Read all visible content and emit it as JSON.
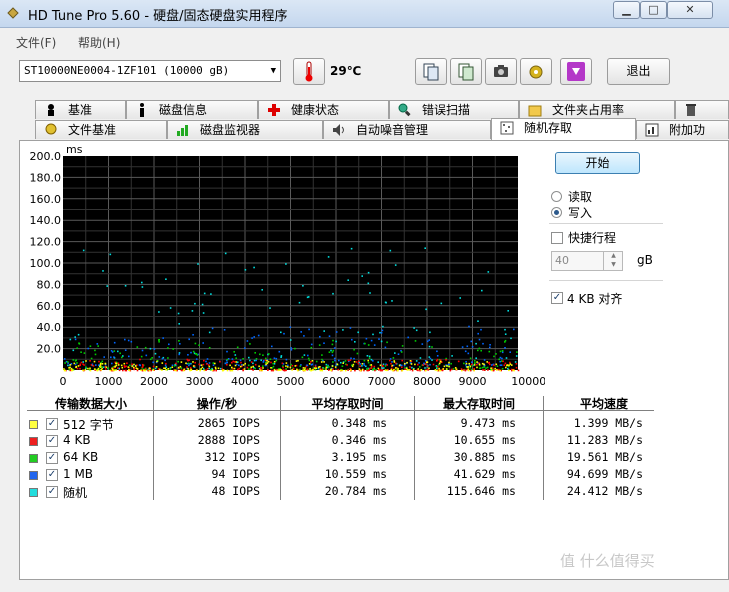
{
  "window": {
    "title": "HD Tune Pro 5.60 - 硬盘/固态硬盘实用程序",
    "minimize_glyph": "▁",
    "maximize_glyph": "□",
    "close_glyph": "✕"
  },
  "menu": {
    "file": "文件(F)",
    "help": "帮助(H)"
  },
  "toolbar": {
    "drive": "ST10000NE0004-1ZF101 (10000 gB)",
    "temperature": "29℃",
    "exit_label": "退出",
    "icons": [
      "copy-info-icon",
      "copy-screenshot-icon",
      "camera-icon",
      "options-icon",
      "save-icon"
    ]
  },
  "tabs_row1": [
    "基准",
    "磁盘信息",
    "健康状态",
    "错误扫描",
    "文件夹占用率",
    ""
  ],
  "tabs_row2": [
    "文件基准",
    "磁盘监视器",
    "自动噪音管理",
    "随机存取",
    "附加功"
  ],
  "active_tab": "随机存取",
  "chart_data": {
    "type": "scatter",
    "ylabel": "ms",
    "xunit": "gB",
    "xlim": [
      0,
      10000
    ],
    "ylim": [
      0,
      200
    ],
    "yticks": [
      "200.0",
      "180.0",
      "160.0",
      "140.0",
      "120.0",
      "100.0",
      "80.0",
      "60.0",
      "40.0",
      "20.0"
    ],
    "xticks": [
      "0",
      "1000",
      "2000",
      "3000",
      "4000",
      "5000",
      "6000",
      "7000",
      "8000",
      "9000",
      "10000gB"
    ],
    "grid": true,
    "background": "#000000",
    "series": [
      {
        "name": "512 字节",
        "color": "#ffff00",
        "ymin": 0.2,
        "ymax": 9.5
      },
      {
        "name": "4 KB",
        "color": "#ff0000",
        "ymin": 0.2,
        "ymax": 10.7
      },
      {
        "name": "64 KB",
        "color": "#00cc00",
        "ymin": 1,
        "ymax": 30.9
      },
      {
        "name": "1 MB",
        "color": "#0066ff",
        "ymin": 5,
        "ymax": 41.6
      },
      {
        "name": "随机",
        "color": "#00dddd",
        "ymin": 2,
        "ymax": 115.6
      }
    ]
  },
  "controls": {
    "start_label": "开始",
    "read_label": "读取",
    "write_label": "写入",
    "selected_mode": "写入",
    "quick_stroke_label": "快捷行程",
    "quick_stroke_checked": false,
    "quick_stroke_value": "40",
    "quick_stroke_unit": "gB",
    "align_label": "4 KB 对齐",
    "align_checked": true
  },
  "results": {
    "headers": [
      "传输数据大小",
      "操作/秒",
      "平均存取时间",
      "最大存取时间",
      "平均速度"
    ],
    "rows": [
      {
        "size": "512 字节",
        "color": "#ffff40",
        "iops": "2865 IOPS",
        "avg": "0.348 ms",
        "max": "9.473 ms",
        "speed": "1.399 MB/s"
      },
      {
        "size": "4 KB",
        "color": "#ee2020",
        "iops": "2888 IOPS",
        "avg": "0.346 ms",
        "max": "10.655 ms",
        "speed": "11.283 MB/s"
      },
      {
        "size": "64 KB",
        "color": "#22cc22",
        "iops": "312 IOPS",
        "avg": "3.195 ms",
        "max": "30.885 ms",
        "speed": "19.561 MB/s"
      },
      {
        "size": "1 MB",
        "color": "#2266ee",
        "iops": "94 IOPS",
        "avg": "10.559 ms",
        "max": "41.629 ms",
        "speed": "94.699 MB/s"
      },
      {
        "size": "随机",
        "color": "#22dddd",
        "iops": "48 IOPS",
        "avg": "20.784 ms",
        "max": "115.646 ms",
        "speed": "24.412 MB/s"
      }
    ]
  },
  "watermark": "值 什么值得买"
}
